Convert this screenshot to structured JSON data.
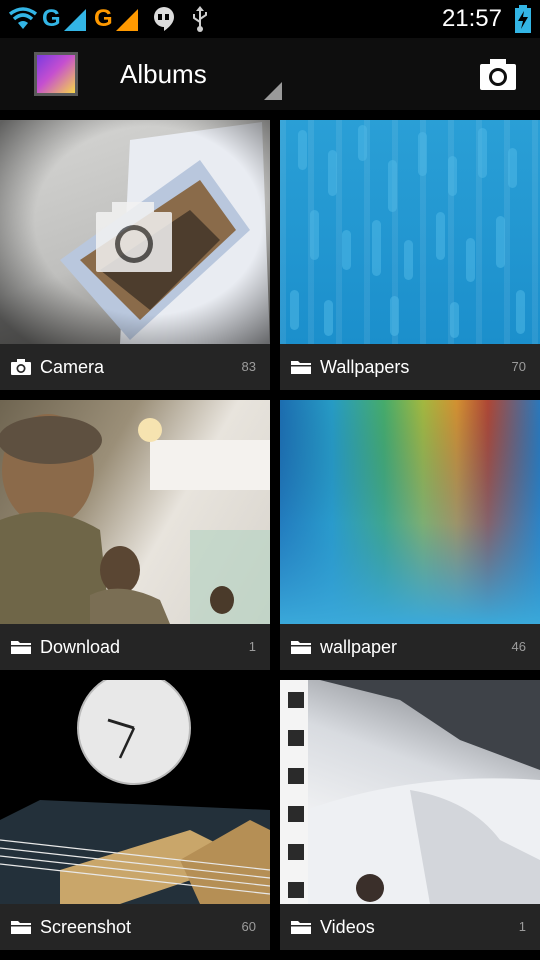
{
  "status_bar": {
    "network_1": "G",
    "network_2": "G",
    "time": "21:57",
    "icons": [
      "wifi-icon",
      "signal-icon",
      "signal-icon",
      "hangouts-icon",
      "usb-icon",
      "battery-charging-icon"
    ]
  },
  "action_bar": {
    "title": "Albums",
    "app_icon": "gallery-icon",
    "action_icon": "camera-icon"
  },
  "albums": [
    {
      "name": "Camera",
      "count": "83",
      "icon": "camera-icon"
    },
    {
      "name": "Wallpapers",
      "count": "70",
      "icon": "folder-icon"
    },
    {
      "name": "Download",
      "count": "1",
      "icon": "folder-icon"
    },
    {
      "name": "wallpaper",
      "count": "46",
      "icon": "folder-icon"
    },
    {
      "name": "Screenshot",
      "count": "60",
      "icon": "folder-icon"
    },
    {
      "name": "Videos",
      "count": "1",
      "icon": "folder-icon"
    }
  ],
  "colors": {
    "accent_battery": "#33b5e5",
    "signal_orange": "#ff9900",
    "signal_blue": "#33b5e5",
    "label_bar": "#282828",
    "count_text": "#9c9c9c"
  }
}
